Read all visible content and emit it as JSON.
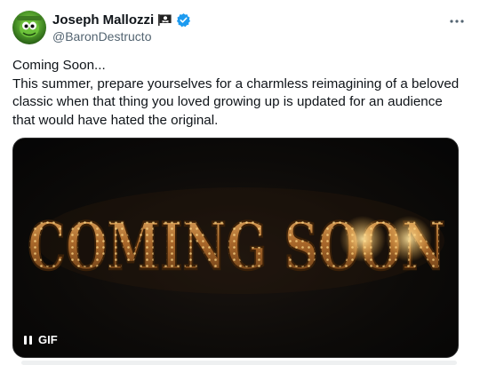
{
  "tweet": {
    "author": {
      "display_name": "Joseph Mallozzi",
      "handle": "@BaronDestructo",
      "name_emoji": "pirate-flag-icon",
      "verified_badge": "verified-icon",
      "verified_color": "#1d9bf0"
    },
    "more_menu": "more-icon",
    "text_lines": [
      "Coming Soon...",
      "This summer, prepare yourselves for a charmless reimagining of a beloved classic when that thing you loved growing up is updated for an audience that would have hated the original."
    ],
    "media": {
      "type": "GIF",
      "headline": "COMING SOON",
      "gif_label": "GIF",
      "pause_icon": "pause-icon",
      "colors": {
        "letter_gold": "#c98a3a",
        "bulb_glow": "#ffd27a",
        "background": "#0a0807"
      }
    }
  }
}
